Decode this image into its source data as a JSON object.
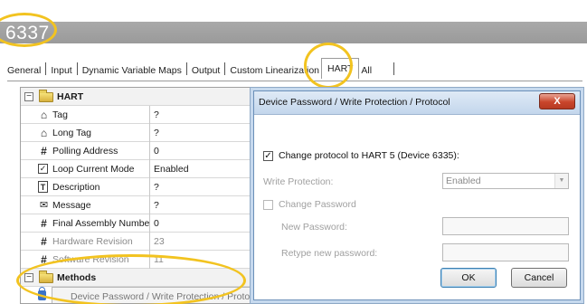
{
  "header": {
    "device_number": "6337"
  },
  "tabs": [
    "General",
    "Input",
    "Dynamic Variable Maps",
    "Output",
    "Custom Linearization",
    "HART",
    "All"
  ],
  "active_tab": "HART",
  "grid": {
    "group_hart": "HART",
    "rows": [
      {
        "icon": "tag-icon",
        "label": "Tag",
        "value": "?"
      },
      {
        "icon": "tag-icon",
        "label": "Long Tag",
        "value": "?"
      },
      {
        "icon": "hash-icon",
        "label": "Polling Address",
        "value": "0"
      },
      {
        "icon": "checkbox-icon",
        "label": "Loop Current Mode",
        "value": "Enabled"
      },
      {
        "icon": "description-icon",
        "label": "Description",
        "value": "?"
      },
      {
        "icon": "message-icon",
        "label": "Message",
        "value": "?"
      },
      {
        "icon": "hash-icon",
        "label": "Final Assembly Number",
        "value": "0"
      },
      {
        "icon": "hash-icon",
        "label": "Hardware Revision",
        "value": "23"
      },
      {
        "icon": "hash-icon",
        "label": "Software Revision",
        "value": "11"
      }
    ],
    "group_methods": "Methods",
    "method_item": "Device Password / Write Protection / Protocol..."
  },
  "dialog": {
    "title": "Device Password / Write Protection / Protocol",
    "close_label": "X",
    "change_protocol_label": "Change protocol to HART 5 (Device 6335):",
    "change_protocol_checked": true,
    "write_protection_label": "Write Protection:",
    "write_protection_value": "Enabled",
    "change_password_label": "Change Password",
    "change_password_checked": false,
    "new_password_label": "New Password:",
    "retype_password_label": "Retype new password:",
    "ok_label": "OK",
    "cancel_label": "Cancel"
  },
  "colors": {
    "highlight": "#f2c320",
    "titlebar": "#9a9a9a",
    "close_button": "#c9452b"
  }
}
